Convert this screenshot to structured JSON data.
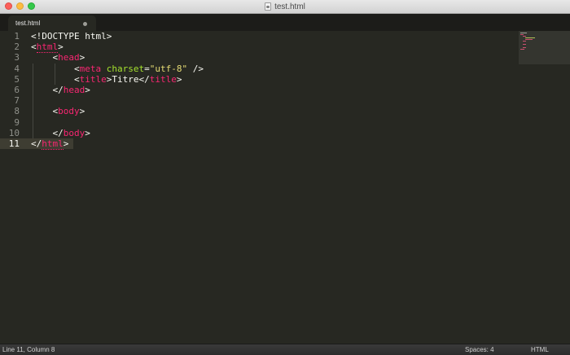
{
  "window": {
    "title": "test.html"
  },
  "tabs": [
    {
      "label": "test.html",
      "modified": true
    }
  ],
  "editor": {
    "line_numbers": [
      "1",
      "2",
      "3",
      "4",
      "5",
      "6",
      "7",
      "8",
      "9",
      "10",
      "11"
    ],
    "active_line": 11,
    "lines": [
      [
        {
          "t": "<!DOCTYPE html>",
          "c": "text"
        }
      ],
      [
        {
          "t": "<",
          "c": "text"
        },
        {
          "t": "html",
          "c": "tag"
        },
        {
          "t": ">",
          "c": "text"
        }
      ],
      [
        {
          "t": "    <",
          "c": "text"
        },
        {
          "t": "head",
          "c": "tag"
        },
        {
          "t": ">",
          "c": "text"
        }
      ],
      [
        {
          "t": "        <",
          "c": "text"
        },
        {
          "t": "meta",
          "c": "tag"
        },
        {
          "t": " ",
          "c": "text"
        },
        {
          "t": "charset",
          "c": "attr"
        },
        {
          "t": "=",
          "c": "text"
        },
        {
          "t": "\"utf-8\"",
          "c": "str"
        },
        {
          "t": " />",
          "c": "text"
        }
      ],
      [
        {
          "t": "        <",
          "c": "text"
        },
        {
          "t": "title",
          "c": "tag"
        },
        {
          "t": ">Titre</",
          "c": "text"
        },
        {
          "t": "title",
          "c": "tag"
        },
        {
          "t": ">",
          "c": "text"
        }
      ],
      [
        {
          "t": "    </",
          "c": "text"
        },
        {
          "t": "head",
          "c": "tag"
        },
        {
          "t": ">",
          "c": "text"
        }
      ],
      [
        {
          "t": "",
          "c": "text"
        }
      ],
      [
        {
          "t": "    <",
          "c": "text"
        },
        {
          "t": "body",
          "c": "tag"
        },
        {
          "t": ">",
          "c": "text"
        }
      ],
      [
        {
          "t": "",
          "c": "text"
        }
      ],
      [
        {
          "t": "    </",
          "c": "text"
        },
        {
          "t": "body",
          "c": "tag"
        },
        {
          "t": ">",
          "c": "text"
        }
      ],
      [
        {
          "t": "</",
          "c": "text"
        },
        {
          "t": "html",
          "c": "tag"
        },
        {
          "t": ">",
          "c": "text"
        }
      ]
    ]
  },
  "colors": {
    "background": "#272822",
    "tag": "#f92672",
    "attribute": "#a6e22e",
    "string": "#e6db74",
    "text": "#f8f8f2",
    "line_number": "#8f908a"
  },
  "statusbar": {
    "position": "Line 11, Column 8",
    "indentation": "Spaces: 4",
    "syntax": "HTML"
  }
}
